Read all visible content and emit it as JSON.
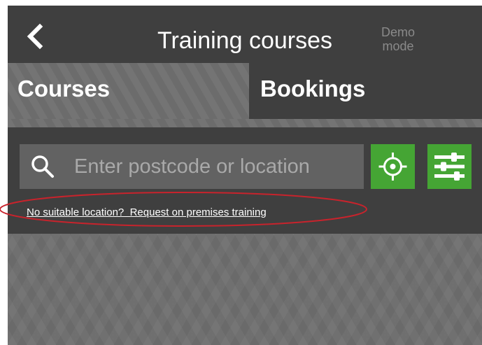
{
  "header": {
    "back_icon": "chevron-left-icon",
    "title": "Training courses",
    "demo_label": "Demo\nmode"
  },
  "tabs": [
    {
      "label": "Courses",
      "active": true
    },
    {
      "label": "Bookings",
      "active": false
    }
  ],
  "search": {
    "icon": "search-icon",
    "placeholder": "Enter postcode or location",
    "value": ""
  },
  "buttons": {
    "locate_icon": "crosshair-icon",
    "filter_icon": "sliders-icon"
  },
  "request_link": "No suitable location?  Request on premises training",
  "colors": {
    "header_bg": "#3f3f3f",
    "active_tab_bg": "#6f6f6f",
    "accent_green": "#45a534",
    "input_bg": "#626262",
    "annotation_red": "#c8232c"
  }
}
